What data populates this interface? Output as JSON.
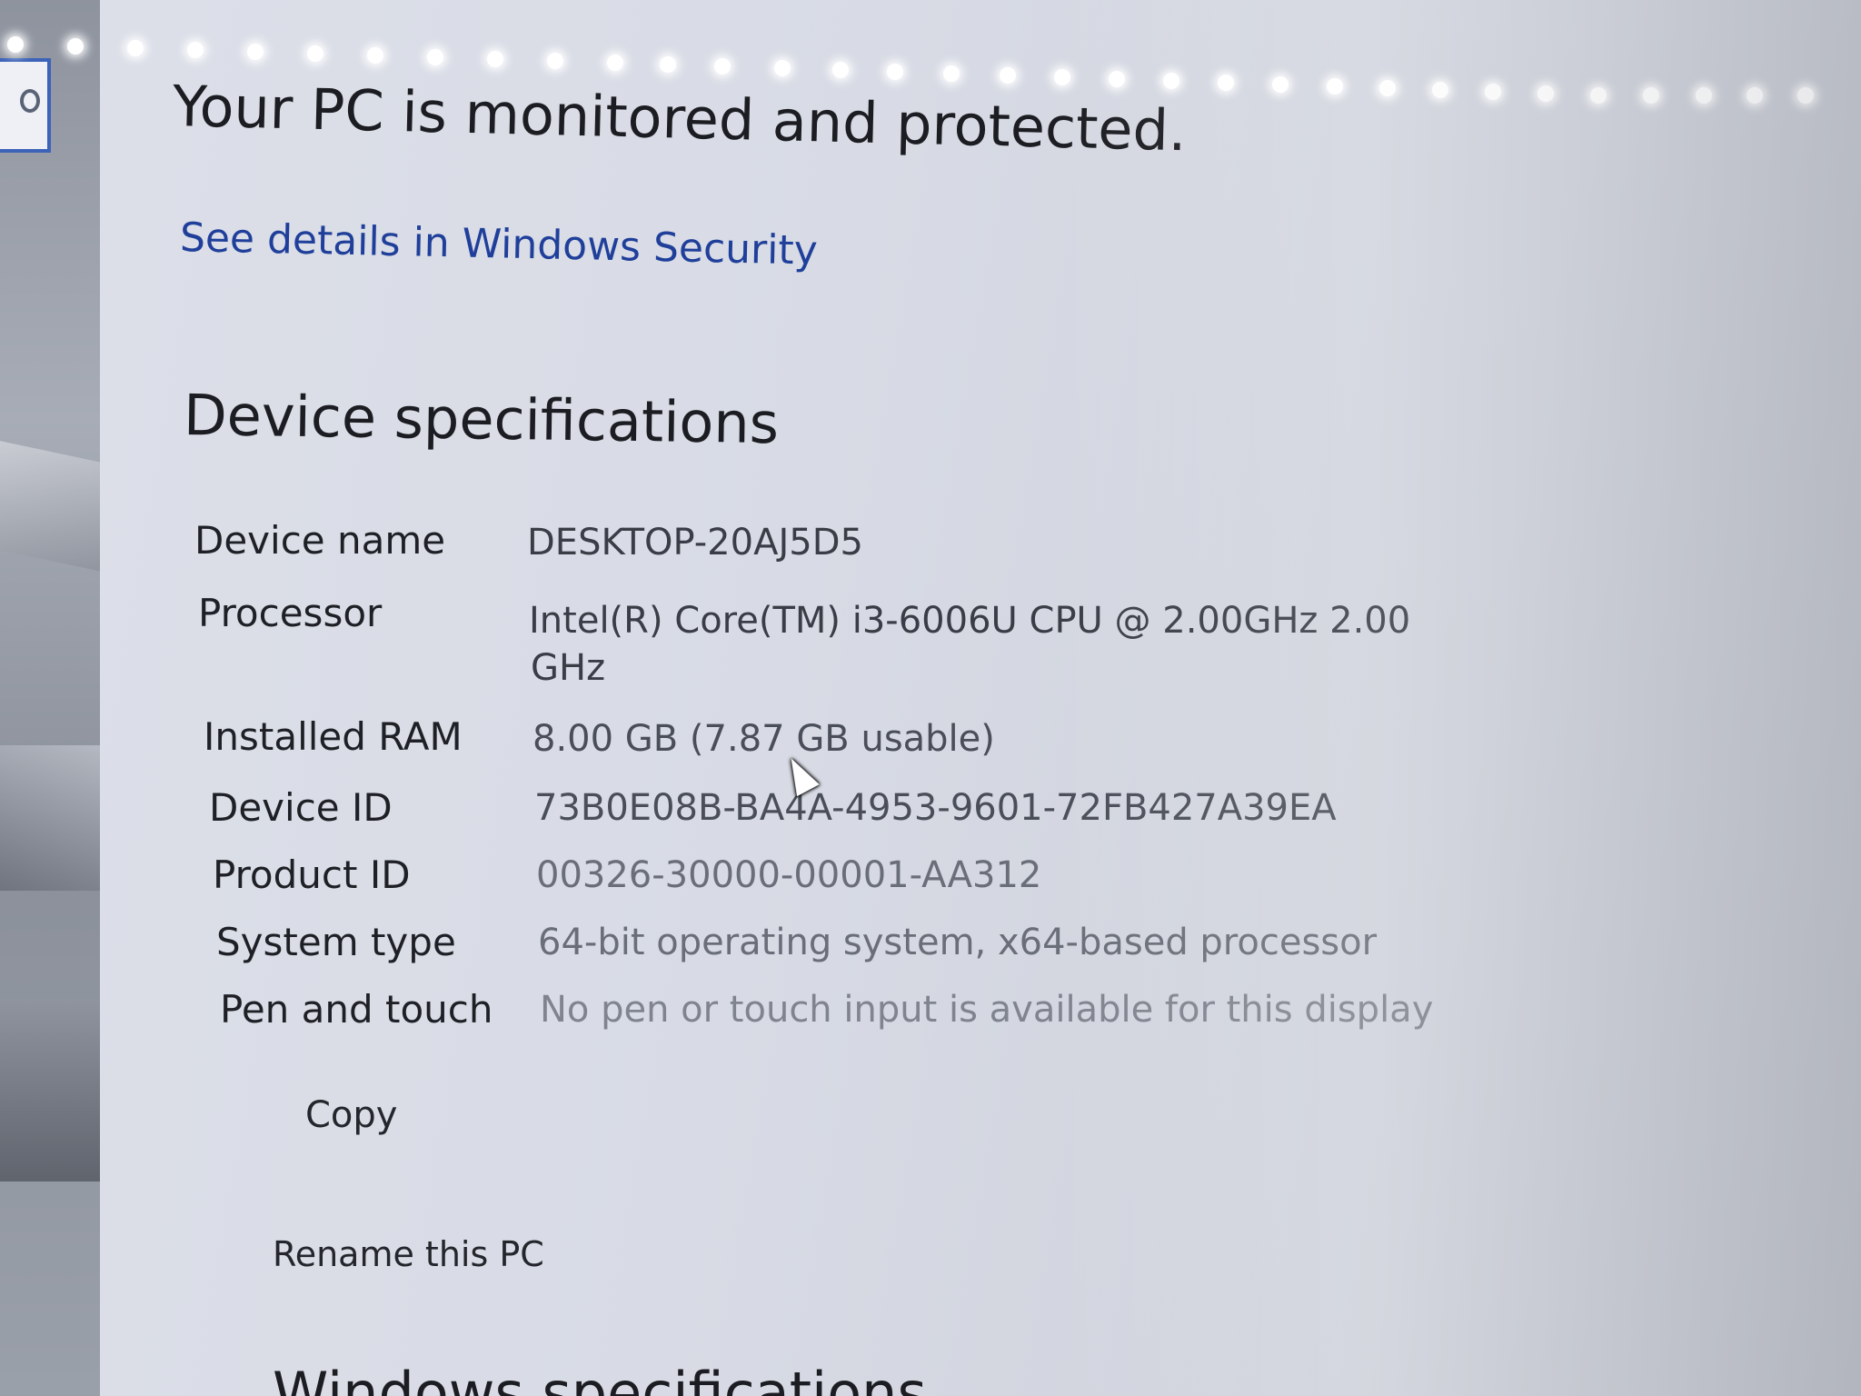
{
  "header": {
    "protection_title": "Your PC is monitored and protected.",
    "security_link": "See details in Windows Security"
  },
  "device_specifications": {
    "heading": "Device specifications",
    "rows": [
      {
        "label": "Device name",
        "value": "DESKTOP-20AJ5D5"
      },
      {
        "label": "Processor",
        "value_line1": "Intel(R) Core(TM) i3-6006U CPU @ 2.00GHz   2.00",
        "value_line2": "GHz"
      },
      {
        "label": "Installed RAM",
        "value": "8.00 GB (7.87 GB usable)"
      },
      {
        "label": "Device ID",
        "value": "73B0E08B-BA4A-4953-9601-72FB427A39EA"
      },
      {
        "label": "Product ID",
        "value": "00326-30000-00001-AA312"
      },
      {
        "label": "System type",
        "value": "64-bit operating system, x64-based processor"
      },
      {
        "label": "Pen and touch",
        "value": "No pen or touch input is available for this display"
      }
    ],
    "copy_label": "Copy",
    "rename_label": "Rename this PC"
  },
  "next_section": {
    "heading_partial": "Windows specifications"
  },
  "icons": {
    "back": "back-arrow-icon",
    "pointer": "mouse-pointer-icon"
  },
  "colors": {
    "link": "#1f3f9a",
    "text": "#1c1d22",
    "accent_border": "#3d63b8"
  }
}
